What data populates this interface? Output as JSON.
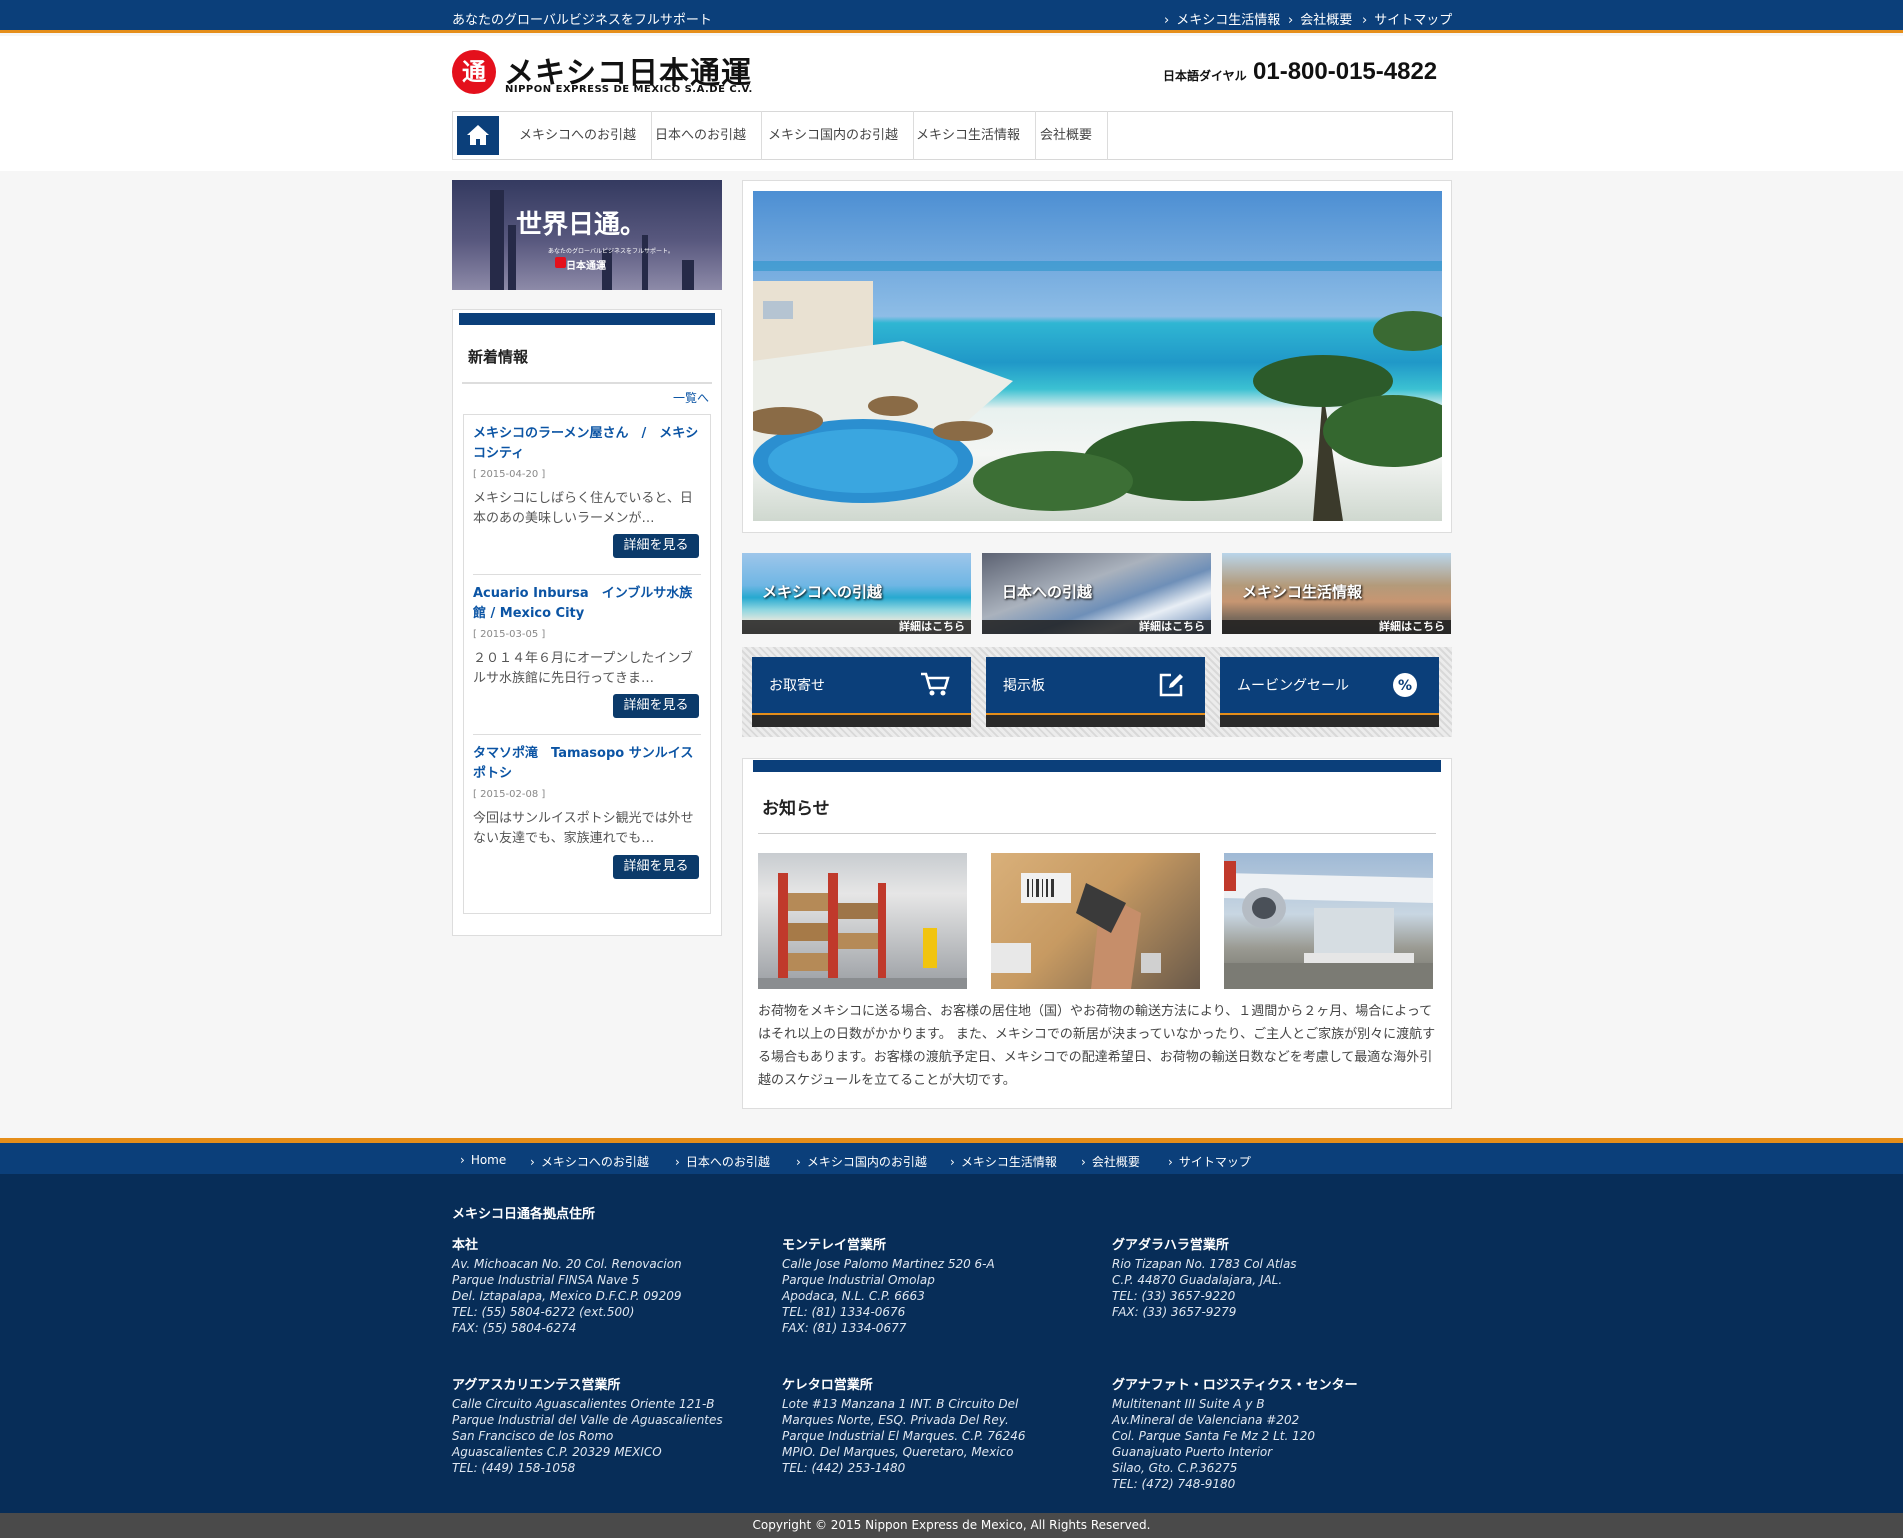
{
  "topbar": {
    "tagline": "あなたのグローバルビジネスをフルサポート",
    "links": [
      "メキシコ生活情報",
      "会社概要",
      "サイトマップ"
    ]
  },
  "header": {
    "logo_mark": "通",
    "logo_title": "メキシコ日本通運",
    "logo_subtitle": "NIPPON EXPRESS DE MEXICO S.A.DE C.V.",
    "dial_label": "日本語ダイヤル",
    "dial_number": "01-800-015-4822"
  },
  "nav": {
    "home_icon": "home-icon",
    "items": [
      "メキシコへのお引越",
      "日本へのお引越",
      "メキシコ国内のお引越",
      "メキシコ生活情報",
      "会社概要"
    ]
  },
  "side_banner": {
    "title": "世界日通。",
    "subtitle": "あなたのグローバルビジネスをフルサポート。",
    "corp": "日本通運"
  },
  "news": {
    "title": "新着情報",
    "more": "一覧へ",
    "items": [
      {
        "title": "メキシコのラーメン屋さん　/　メキシコシティ",
        "date": "[ 2015-04-20 ]",
        "excerpt": "メキシコにしばらく住んでいると、日本のあの美味しいラーメンが…",
        "button": "詳細を見る"
      },
      {
        "title": "Acuario Inbursa　インブルサ水族館 / Mexico City",
        "date": "[ 2015-03-05 ]",
        "excerpt": "２０１４年６月にオープンしたインブルサ水族館に先日行ってきま…",
        "button": "詳細を見る"
      },
      {
        "title": "タマソポ滝　Tamasopo サンルイスポトシ",
        "date": "[ 2015-02-08 ]",
        "excerpt": "今回はサンルイスポトシ観光では外せない友達でも、家族連れでも…",
        "button": "詳細を見る"
      }
    ]
  },
  "promos": [
    {
      "label": "メキシコへの引越",
      "foot": "詳細はこちら"
    },
    {
      "label": "日本への引越",
      "foot": "詳細はこちら"
    },
    {
      "label": "メキシコ生活情報",
      "foot": "詳細はこちら"
    }
  ],
  "services": [
    {
      "label": "お取寄せ",
      "icon": "cart-icon"
    },
    {
      "label": "掲示板",
      "icon": "edit-icon"
    },
    {
      "label": "ムービングセール",
      "icon": "percent-badge-icon"
    }
  ],
  "notice": {
    "title": "お知らせ",
    "text": "お荷物をメキシコに送る場合、お客様の居住地（国）やお荷物の輸送方法により、１週間から２ヶ月、場合によってはそれ以上の日数がかかります。 また、メキシコでの新居が決まっていなかったり、ご主人とご家族が別々に渡航する場合もあります。お客様の渡航予定日、メキシコでの配達希望日、お荷物の輸送日数などを考慮して最適な海外引越のスケジュールを立てることが大切です。"
  },
  "footer_nav": [
    "Home",
    "メキシコへのお引越",
    "日本へのお引越",
    "メキシコ国内のお引越",
    "メキシコ生活情報",
    "会社概要",
    "サイトマップ"
  ],
  "footer": {
    "title": "メキシコ日通各拠点住所",
    "offices": [
      {
        "name": "本社",
        "lines": [
          "Av. Michoacan No. 20 Col. Renovacion",
          "Parque Industrial FINSA Nave 5",
          "Del. Iztapalapa, Mexico D.F.C.P. 09209",
          "TEL: (55) 5804-6272 (ext.500)",
          "FAX: (55) 5804-6274"
        ]
      },
      {
        "name": "モンテレイ営業所",
        "lines": [
          "Calle Jose Palomo Martinez 520 6-A",
          "Parque Industrial Omolap",
          "Apodaca, N.L. C.P. 6663",
          "TEL: (81) 1334-0676",
          "FAX: (81) 1334-0677"
        ]
      },
      {
        "name": "グアダラハラ営業所",
        "lines": [
          "Rio Tizapan No. 1783 Col Atlas",
          "C.P. 44870 Guadalajara, JAL.",
          "TEL: (33) 3657-9220",
          "FAX: (33) 3657-9279"
        ]
      },
      {
        "name": "アグアスカリエンテス営業所",
        "lines": [
          "Calle Circuito Aguascalientes Oriente 121-B",
          "Parque Industrial del Valle de Aguascalientes",
          "San Francisco de los Romo",
          "Aguascalientes C.P. 20329 MEXICO",
          "TEL: (449) 158-1058"
        ]
      },
      {
        "name": "ケレタロ営業所",
        "lines": [
          "Lote #13 Manzana 1 INT. B Circuito Del",
          "Marques Norte, ESQ. Privada Del Rey.",
          "Parque Industrial El Marques. C.P. 76246",
          "MPIO. Del Marques, Queretaro, Mexico",
          "TEL: (442) 253-1480"
        ]
      },
      {
        "name": "グアナファト・ロジスティクス・センター",
        "lines": [
          "Multitenant III Suite A y B",
          "Av.Mineral de Valenciana #202",
          "Col. Parque Santa Fe Mz 2 Lt. 120",
          "Guanajuato Puerto Interior",
          "Silao, Gto. C.P.36275",
          "TEL: (472) 748-9180"
        ]
      }
    ],
    "copyright": "Copyright © 2015 Nippon Express de Mexico, All Rights Reserved."
  }
}
